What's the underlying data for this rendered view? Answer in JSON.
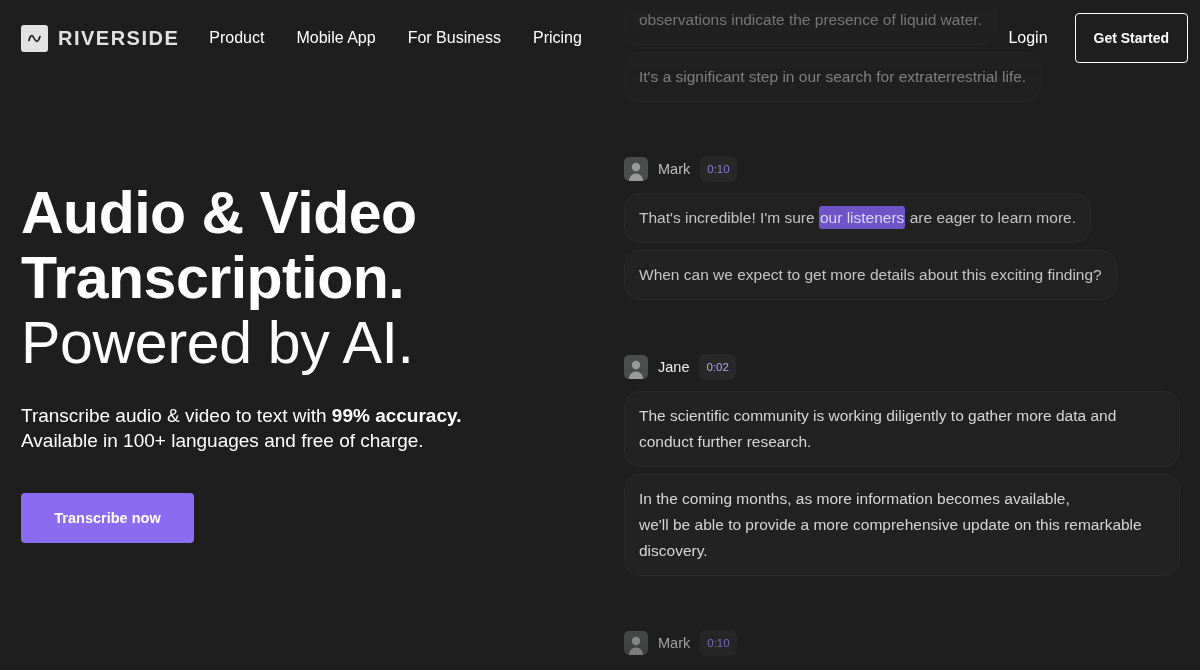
{
  "nav": {
    "logo": "RIVERSIDE",
    "links": [
      "Product",
      "Mobile App",
      "For Business",
      "Pricing"
    ],
    "login": "Login",
    "cta": "Get Started"
  },
  "hero": {
    "title": "Audio & Video Transcription.",
    "tagline": "Powered by AI.",
    "description": "Transcribe audio & video to text with **99% accuracy.** Available in 100+ languages and free of charge.",
    "button": "Transcribe now"
  },
  "transcript": {
    "segments": [
      {
        "messages": [
          {
            "parts": [
              {
                "text": "observations indicate the presence of liquid water.",
                "highlighted": false
              }
            ]
          },
          {
            "parts": [
              {
                "text": "It's a significant step in our search for extraterrestrial life.",
                "highlighted": false
              }
            ]
          }
        ]
      },
      {
        "speaker": "Mark",
        "time": "0:10",
        "active": false,
        "messages": [
          {
            "parts": [
              {
                "text": "That's incredible! I'm sure ",
                "highlighted": false
              },
              {
                "text": "our listeners",
                "highlighted": true
              },
              {
                "text": " are eager to learn more.",
                "highlighted": false
              }
            ]
          },
          {
            "parts": [
              {
                "text": "When can we expect to get more details about this exciting finding?",
                "highlighted": false
              }
            ]
          }
        ]
      },
      {
        "speaker": "Jane",
        "time": "0:02",
        "active": true,
        "messages": [
          {
            "parts": [
              {
                "text": "The scientific community is working diligently to gather more data and conduct further research.",
                "highlighted": false
              }
            ]
          },
          {
            "parts": [
              {
                "text": "In the coming months, as more information becomes available,\nwe'll be able to provide a more comprehensive update on this remarkable discovery.",
                "highlighted": false
              }
            ]
          }
        ]
      },
      {
        "speaker": "Mark",
        "time": "0:10",
        "active": false
      }
    ]
  }
}
